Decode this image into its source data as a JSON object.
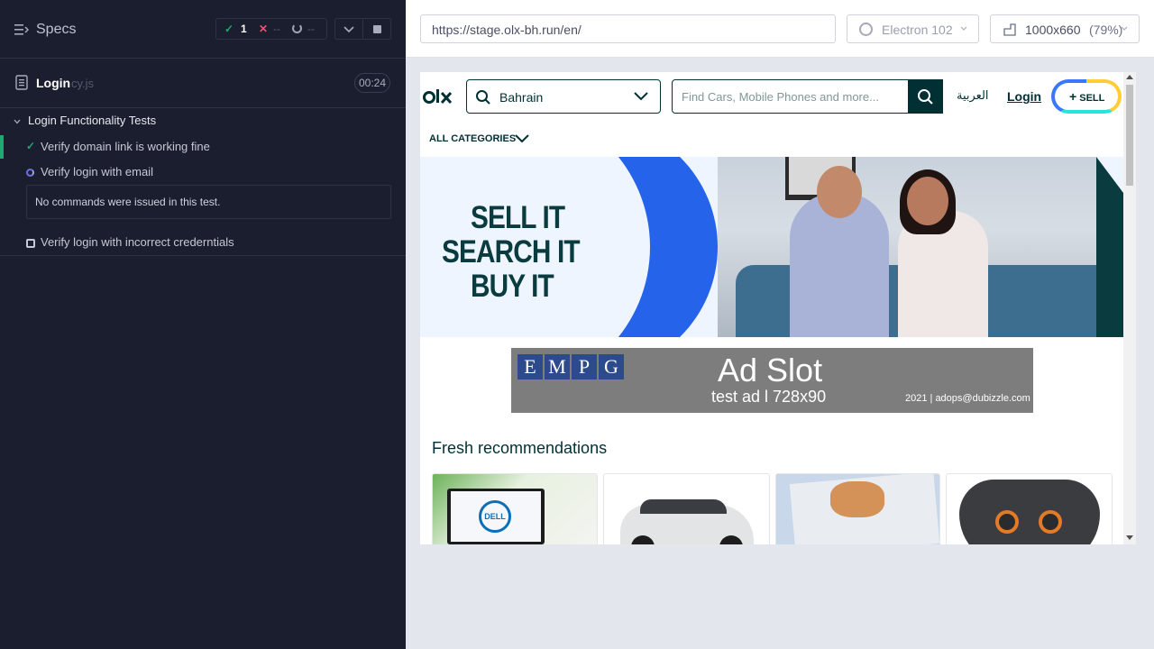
{
  "runner": {
    "specs_label": "Specs",
    "stats": {
      "passed": "1",
      "failed": "--",
      "pending": "--"
    },
    "file": {
      "name": "Login",
      "ext": "cy.js",
      "duration": "00:24"
    },
    "suite": {
      "title": "Login Functionality Tests",
      "tests": [
        {
          "label": "Verify domain link is working fine",
          "state": "passed"
        },
        {
          "label": "Verify login with email",
          "state": "running"
        },
        {
          "label": "Verify login with incorrect crederntials",
          "state": "pending"
        }
      ],
      "no_commands_message": "No commands were issued in this test."
    }
  },
  "browser_bar": {
    "url": "https://stage.olx-bh.run/en/",
    "browser": "Electron 102",
    "viewport_size": "1000x660",
    "viewport_zoom": "(79%)"
  },
  "app": {
    "location": "Bahrain",
    "search_placeholder": "Find Cars, Mobile Phones and more...",
    "lang_link": "العربية",
    "login": "Login",
    "sell": "SELL",
    "all_categories": "ALL CATEGORIES",
    "banner": {
      "line1": "SELL IT",
      "line2": "SEARCH IT",
      "line3": "BUY IT"
    },
    "ad": {
      "logo_letters": [
        "E",
        "M",
        "P",
        "G"
      ],
      "title": "Ad Slot",
      "subtitle": "test ad l 728x90",
      "contact": "2021 | adops@dubizzle.com"
    },
    "fresh_title": "Fresh recommendations",
    "card_dell_text": "DELL"
  },
  "colors": {
    "runner_bg": "#1b1e2e",
    "pass": "#1fa971",
    "fail": "#e45770",
    "olx_dark": "#002f34",
    "banner_blue": "#2563eb"
  }
}
